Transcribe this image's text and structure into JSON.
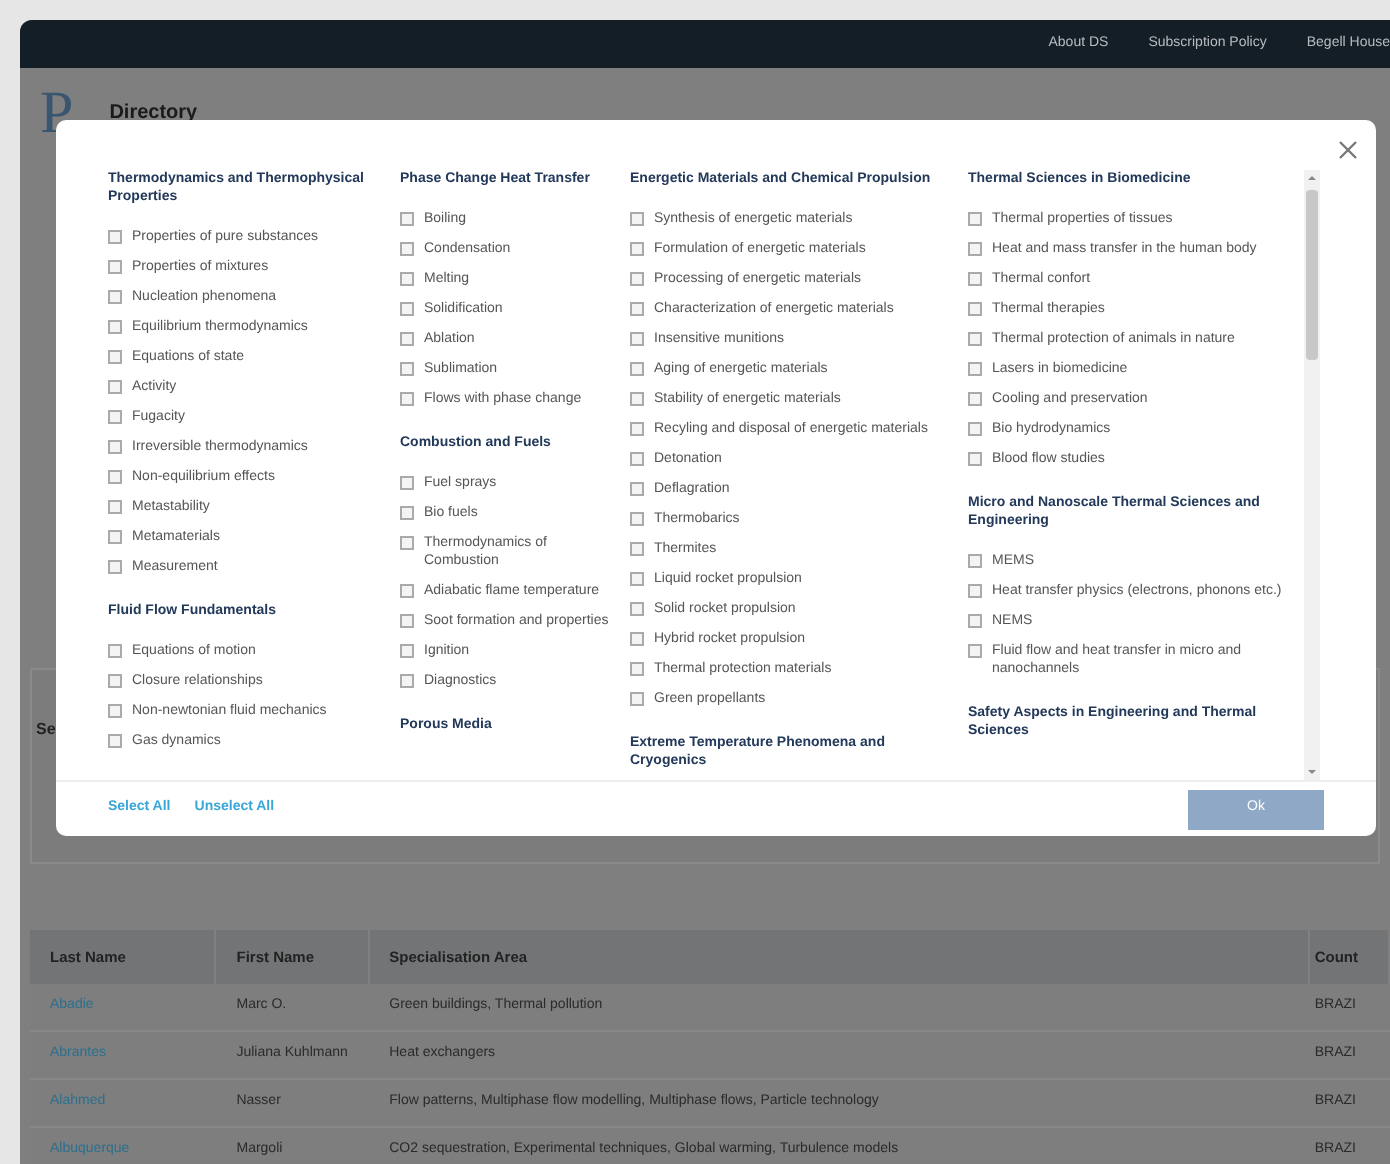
{
  "nav": {
    "links": [
      "About DS",
      "Subscription Policy",
      "Begell House"
    ]
  },
  "page": {
    "logo": "P",
    "title": "Directory",
    "section_fragment": "Se"
  },
  "modal": {
    "columns": [
      {
        "sections": [
          {
            "title": "Thermodynamics and Thermophysical Properties",
            "items": [
              {
                "label": "Properties of pure substances",
                "checked": false
              },
              {
                "label": "Properties of mixtures",
                "checked": false
              },
              {
                "label": "Nucleation phenomena",
                "checked": false
              },
              {
                "label": "Equilibrium thermodynamics",
                "checked": false
              },
              {
                "label": "Equations of state",
                "checked": false
              },
              {
                "label": "Activity",
                "checked": false
              },
              {
                "label": "Fugacity",
                "checked": false
              },
              {
                "label": "Irreversible thermodynamics",
                "checked": false
              },
              {
                "label": "Non-equilibrium effects",
                "checked": false
              },
              {
                "label": "Metastability",
                "checked": false
              },
              {
                "label": "Metamaterials",
                "checked": false
              },
              {
                "label": "Measurement",
                "checked": false
              }
            ]
          },
          {
            "title": "Fluid Flow Fundamentals",
            "items": [
              {
                "label": "Equations of motion",
                "checked": false
              },
              {
                "label": "Closure relationships",
                "checked": false
              },
              {
                "label": "Non-newtonian fluid mechanics",
                "checked": false
              },
              {
                "label": "Gas dynamics",
                "checked": false
              }
            ]
          }
        ]
      },
      {
        "sections": [
          {
            "title": "Phase Change Heat Transfer",
            "items": [
              {
                "label": "Boiling",
                "checked": false
              },
              {
                "label": "Condensation",
                "checked": false
              },
              {
                "label": "Melting",
                "checked": false
              },
              {
                "label": "Solidification",
                "checked": false
              },
              {
                "label": "Ablation",
                "checked": false
              },
              {
                "label": "Sublimation",
                "checked": false
              },
              {
                "label": "Flows with phase change",
                "checked": false
              }
            ]
          },
          {
            "title": "Combustion and Fuels",
            "items": [
              {
                "label": "Fuel sprays",
                "checked": false
              },
              {
                "label": "Bio fuels",
                "checked": false
              },
              {
                "label": "Thermodynamics of Combustion",
                "checked": false
              },
              {
                "label": "Adiabatic flame temperature",
                "checked": false
              },
              {
                "label": "Soot formation and properties",
                "checked": false
              },
              {
                "label": "Ignition",
                "checked": false
              },
              {
                "label": "Diagnostics",
                "checked": false
              }
            ]
          },
          {
            "title": "Porous Media"
          }
        ]
      },
      {
        "sections": [
          {
            "title": "Energetic Materials and Chemical Propulsion",
            "items": [
              {
                "label": "Synthesis of energetic materials",
                "checked": false
              },
              {
                "label": "Formulation of energetic materials",
                "checked": false
              },
              {
                "label": "Processing of energetic materials",
                "checked": false
              },
              {
                "label": "Characterization of energetic materials",
                "checked": false
              },
              {
                "label": "Insensitive munitions",
                "checked": false
              },
              {
                "label": "Aging of energetic materials",
                "checked": false
              },
              {
                "label": "Stability of energetic materials",
                "checked": false
              },
              {
                "label": "Recyling and disposal of energetic materials",
                "checked": false
              },
              {
                "label": "Detonation",
                "checked": false
              },
              {
                "label": "Deflagration",
                "checked": false
              },
              {
                "label": "Thermobarics",
                "checked": false
              },
              {
                "label": "Thermites",
                "checked": false
              },
              {
                "label": "Liquid rocket propulsion",
                "checked": false
              },
              {
                "label": "Solid rocket propulsion",
                "checked": false
              },
              {
                "label": "Hybrid rocket propulsion",
                "checked": false
              },
              {
                "label": "Thermal protection materials",
                "checked": false
              },
              {
                "label": "Green propellants",
                "checked": false
              }
            ]
          },
          {
            "title": "Extreme Temperature Phenomena and Cryogenics"
          }
        ]
      },
      {
        "sections": [
          {
            "title": "Thermal Sciences in Biomedicine",
            "items": [
              {
                "label": "Thermal properties of tissues",
                "checked": false
              },
              {
                "label": "Heat and mass transfer in the human body",
                "checked": false
              },
              {
                "label": "Thermal confort",
                "checked": false
              },
              {
                "label": "Thermal therapies",
                "checked": false
              },
              {
                "label": "Thermal protection of animals in nature",
                "checked": false
              },
              {
                "label": "Lasers in biomedicine",
                "checked": false
              },
              {
                "label": "Cooling and preservation",
                "checked": false
              },
              {
                "label": "Bio hydrodynamics",
                "checked": false
              },
              {
                "label": "Blood flow studies",
                "checked": false
              }
            ]
          },
          {
            "title": "Micro and Nanoscale Thermal Sciences and Engineering",
            "items": [
              {
                "label": "MEMS",
                "checked": false
              },
              {
                "label": "Heat transfer physics (electrons, phonons etc.)",
                "checked": false
              },
              {
                "label": "NEMS",
                "checked": false
              },
              {
                "label": "Fluid flow and heat transfer in micro and nanochannels",
                "checked": false
              }
            ]
          },
          {
            "title": "Safety Aspects in Engineering and Thermal Sciences"
          }
        ]
      }
    ],
    "footer_links": [
      "Select All",
      "Unselect All"
    ],
    "ok_button": "Ok"
  },
  "table": {
    "columns": [
      "Last Name",
      "First Name",
      "Specialisation Area",
      "Count"
    ],
    "rows": [
      [
        "Abadie",
        "Marc O.",
        "Green buildings, Thermal pollution",
        "BRAZI"
      ],
      [
        "Abrantes",
        "Juliana Kuhlmann",
        "Heat exchangers",
        "BRAZI"
      ],
      [
        "Alahmed",
        "Nasser",
        "Flow patterns, Multiphase flow modelling, Multiphase flows, Particle technology",
        "BRAZI"
      ],
      [
        "Albuquerque",
        "Margoli",
        "CO2 sequestration, Experimental techniques, Global warming, Turbulence models",
        "BRAZI"
      ]
    ]
  }
}
